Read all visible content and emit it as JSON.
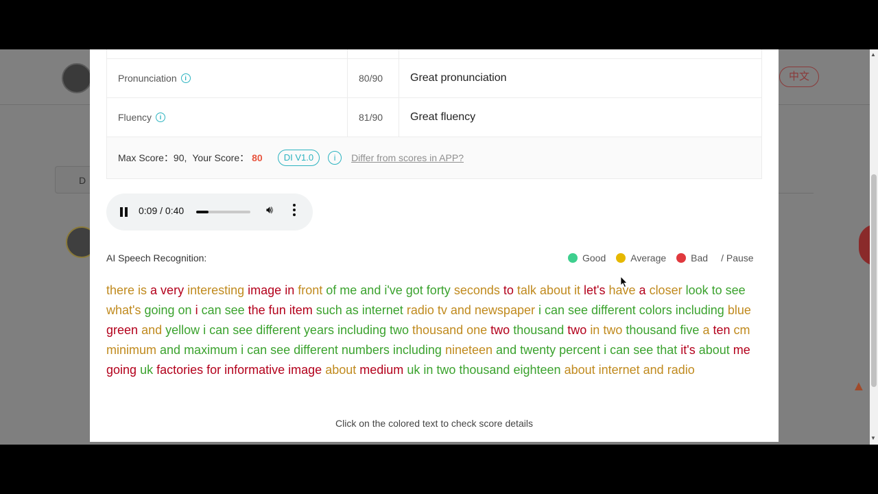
{
  "background": {
    "lang_button": "中文",
    "discuss_tab": "D"
  },
  "table": {
    "rows": [
      {
        "name": "Pronunciation",
        "score": "80/90",
        "comment": "Great pronunciation"
      },
      {
        "name": "Fluency",
        "score": "81/90",
        "comment": "Great fluency"
      }
    ],
    "info_glyph": "i"
  },
  "summary": {
    "max_label": "Max Score：90,",
    "your_label": "Your Score：",
    "your_score": "80",
    "version_badge": "DI V1.0",
    "info_glyph": "i",
    "diff_link": "Differ from scores in APP?"
  },
  "audio": {
    "time": "0:09 / 0:40",
    "progress": 0.225
  },
  "recognition": {
    "label": "AI Speech Recognition:",
    "legend": [
      {
        "label": "Good",
        "color": "#3ecf8e"
      },
      {
        "label": "Average",
        "color": "#e6b800"
      },
      {
        "label": "Bad",
        "color": "#e0393e"
      }
    ],
    "pause_label": "/ Pause",
    "colors": {
      "good": "#3ba22e",
      "average": "#c08a1e",
      "bad": "#b3001b"
    },
    "words": [
      [
        "there is",
        "average"
      ],
      [
        "a very",
        "bad"
      ],
      [
        "interesting",
        "average"
      ],
      [
        "image in",
        "bad"
      ],
      [
        "front",
        "average"
      ],
      [
        "of me and i've got forty",
        "good"
      ],
      [
        "seconds",
        "average"
      ],
      [
        "to",
        "bad"
      ],
      [
        "talk about it",
        "average"
      ],
      [
        "let's",
        "bad"
      ],
      [
        "have",
        "average"
      ],
      [
        "a",
        "bad"
      ],
      [
        "closer",
        "average"
      ],
      [
        "look to see",
        "good"
      ],
      [
        "what's",
        "average"
      ],
      [
        "going on",
        "good"
      ],
      [
        "i",
        "bad"
      ],
      [
        "can see",
        "good"
      ],
      [
        "the fun item",
        "bad"
      ],
      [
        "such as internet",
        "good"
      ],
      [
        "radio tv",
        "average"
      ],
      [
        "and newspaper",
        "average"
      ],
      [
        "i can see different colors including",
        "good"
      ],
      [
        "blue",
        "average"
      ],
      [
        "green",
        "bad"
      ],
      [
        "and",
        "average"
      ],
      [
        "yellow",
        "good"
      ],
      [
        "i can see different years including two",
        "good"
      ],
      [
        "thousand one",
        "average"
      ],
      [
        "two",
        "bad"
      ],
      [
        "thousand",
        "good"
      ],
      [
        "two",
        "bad"
      ],
      [
        "in two",
        "average"
      ],
      [
        "thousand five",
        "good"
      ],
      [
        "a",
        "average"
      ],
      [
        "ten",
        "bad"
      ],
      [
        "cm",
        "average"
      ],
      [
        "minimum",
        "average"
      ],
      [
        "and maximum",
        "good"
      ],
      [
        "i can see different numbers including",
        "good"
      ],
      [
        "nineteen",
        "average"
      ],
      [
        "and twenty percent",
        "good"
      ],
      [
        "i can see that",
        "good"
      ],
      [
        "it's",
        "bad"
      ],
      [
        "about",
        "good"
      ],
      [
        "me going",
        "bad"
      ],
      [
        "uk",
        "good"
      ],
      [
        "factories for informative image",
        "bad"
      ],
      [
        "about",
        "average"
      ],
      [
        "medium",
        "bad"
      ],
      [
        "uk in two",
        "good"
      ],
      [
        "thousand",
        "good"
      ],
      [
        "eighteen",
        "good"
      ],
      [
        "about",
        "average"
      ],
      [
        "internet and radio",
        "average"
      ]
    ],
    "hint": "Click on the colored text to check score details"
  }
}
